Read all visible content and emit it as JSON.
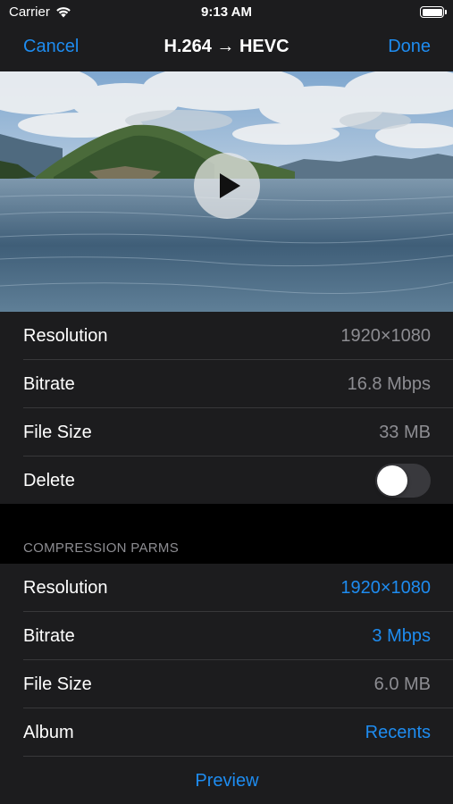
{
  "status_bar": {
    "carrier": "Carrier",
    "time": "9:13 AM",
    "battery_level": 1.0
  },
  "nav": {
    "cancel_label": "Cancel",
    "title": "H.264 → HEVC",
    "done_label": "Done"
  },
  "video": {
    "play_icon": "play-icon"
  },
  "source_info": {
    "rows": [
      {
        "label": "Resolution",
        "value": "1920×1080"
      },
      {
        "label": "Bitrate",
        "value": "16.8 Mbps"
      },
      {
        "label": "File Size",
        "value": "33 MB"
      }
    ],
    "delete": {
      "label": "Delete",
      "on": false
    }
  },
  "compression": {
    "header": "COMPRESSION PARMS",
    "rows": [
      {
        "label": "Resolution",
        "value": "1920×1080",
        "editable": true
      },
      {
        "label": "Bitrate",
        "value": "3 Mbps",
        "editable": true
      },
      {
        "label": "File Size",
        "value": "6.0 MB",
        "editable": false
      },
      {
        "label": "Album",
        "value": "Recents",
        "editable": true
      }
    ],
    "preview_label": "Preview"
  },
  "colors": {
    "accent": "#1e8cf0",
    "cell_background": "#1c1c1e",
    "secondary_text": "#8d8d92",
    "toggle_off": "#39393d"
  }
}
